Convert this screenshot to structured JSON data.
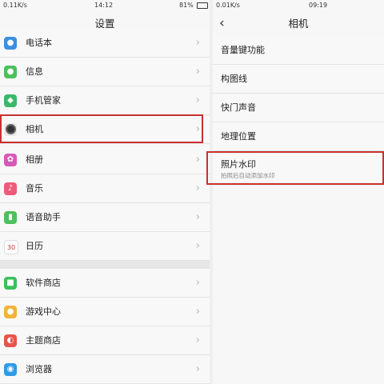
{
  "left": {
    "status": {
      "speed": "0.11K/s",
      "time": "14:12",
      "battery": "81%"
    },
    "title": "设置",
    "items": [
      {
        "label": "电话本",
        "icon": "contacts-icon",
        "color": "#3b8fe0"
      },
      {
        "label": "信息",
        "icon": "message-icon",
        "color": "#4cc05a"
      },
      {
        "label": "手机管家",
        "icon": "shield-icon",
        "color": "#3bb86b"
      },
      {
        "label": "相机",
        "icon": "camera-icon",
        "color": "#e8e8e8"
      },
      {
        "label": "相册",
        "icon": "album-icon",
        "color": "#d659b8"
      },
      {
        "label": "音乐",
        "icon": "music-icon",
        "color": "#ef5a7a"
      },
      {
        "label": "语音助手",
        "icon": "microphone-icon",
        "color": "#4cc05a"
      },
      {
        "label": "日历",
        "icon": "calendar-icon",
        "color": "#ffffff",
        "calendar_day": "30"
      },
      {
        "label": "软件商店",
        "icon": "app-store-icon",
        "color": "#3bbf5c"
      },
      {
        "label": "游戏中心",
        "icon": "game-icon",
        "color": "#f2b33a"
      },
      {
        "label": "主题商店",
        "icon": "theme-icon",
        "color": "#e7544d"
      },
      {
        "label": "浏览器",
        "icon": "browser-icon",
        "color": "#2f9be6"
      }
    ]
  },
  "right": {
    "status": {
      "speed": "0.01K/s",
      "time": "09:19"
    },
    "title": "相机",
    "items": [
      {
        "label": "音量键功能"
      },
      {
        "label": "构图线"
      },
      {
        "label": "快门声音"
      },
      {
        "label": "地理位置"
      },
      {
        "label": "照片水印",
        "sublabel": "拍照后自动添加水印"
      }
    ]
  },
  "accent": "#c8312f"
}
